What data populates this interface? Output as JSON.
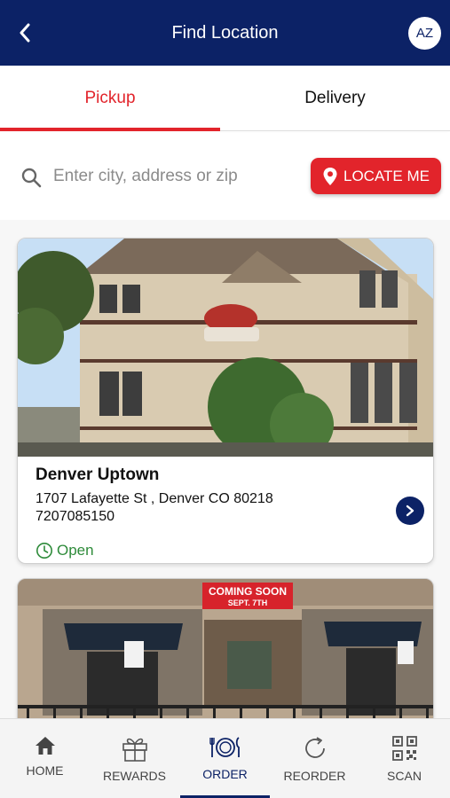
{
  "header": {
    "title": "Find Location",
    "avatar_initials": "AZ"
  },
  "tabs": [
    {
      "label": "Pickup",
      "active": true
    },
    {
      "label": "Delivery",
      "active": false
    }
  ],
  "search": {
    "placeholder": "Enter city, address or zip",
    "value": "",
    "locate_label": "LOCATE ME"
  },
  "locations": [
    {
      "name": "Denver Uptown",
      "address": "1707 Lafayette St , Denver CO 80218",
      "phone": "7207085150",
      "status": "Open"
    },
    {
      "sign_line1": "COMING SOON",
      "sign_line2": "SEPT. 7TH"
    }
  ],
  "nav": [
    {
      "label": "HOME",
      "icon": "home-icon"
    },
    {
      "label": "REWARDS",
      "icon": "gift-icon"
    },
    {
      "label": "ORDER",
      "icon": "plate-icon",
      "active": true
    },
    {
      "label": "REORDER",
      "icon": "refresh-icon"
    },
    {
      "label": "SCAN",
      "icon": "qr-icon"
    }
  ],
  "colors": {
    "brand_navy": "#0c2266",
    "accent_red": "#e2242b",
    "open_green": "#2e8b3a"
  }
}
